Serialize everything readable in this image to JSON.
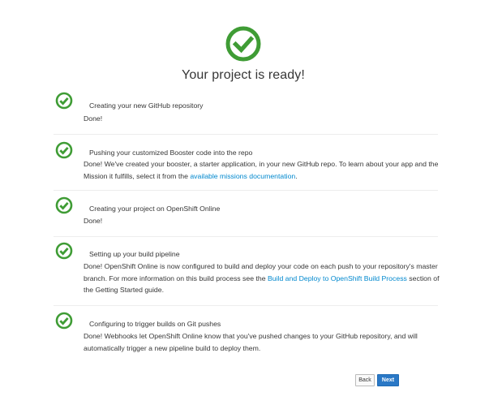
{
  "header": {
    "title": "Your project is ready!",
    "icon": "check-circle-icon",
    "accent_color": "#3f9c35"
  },
  "steps": [
    {
      "icon": "check-circle-icon",
      "title": "Creating your new GitHub repository",
      "desc_before": "Done!",
      "link": "",
      "link2": "",
      "desc_after": ""
    },
    {
      "icon": "check-circle-icon",
      "title": "Pushing your customized Booster code into the repo",
      "desc_before": "Done! We've created your booster, a starter application, in your new GitHub repo. To learn about your app and the Mission it fulfills, select it from the ",
      "link": "available missions documentation",
      "link2": "",
      "desc_after": "."
    },
    {
      "icon": "check-circle-icon",
      "title": "Creating your project on OpenShift Online",
      "desc_before": "Done!",
      "link": "",
      "link2": "",
      "desc_after": ""
    },
    {
      "icon": "check-circle-icon",
      "title": "Setting up your build pipeline",
      "desc_before": "Done! OpenShift Online is now configured to build and deploy your code on each push to your repository's master branch. For more information on this build process see the ",
      "link": "Build and Deploy to",
      "link2": "OpenShift Build Process",
      "desc_after": " section of the Getting Started guide."
    },
    {
      "icon": "check-circle-icon",
      "title": "Configuring to trigger builds on Git pushes",
      "desc_before": "Done! Webhooks let OpenShift Online know that you've pushed changes to your GitHub repository, and will automatically trigger a new pipeline build to deploy them.",
      "link": "",
      "link2": "",
      "desc_after": ""
    }
  ],
  "footer": {
    "back_label": "Back",
    "next_label": "Next"
  }
}
